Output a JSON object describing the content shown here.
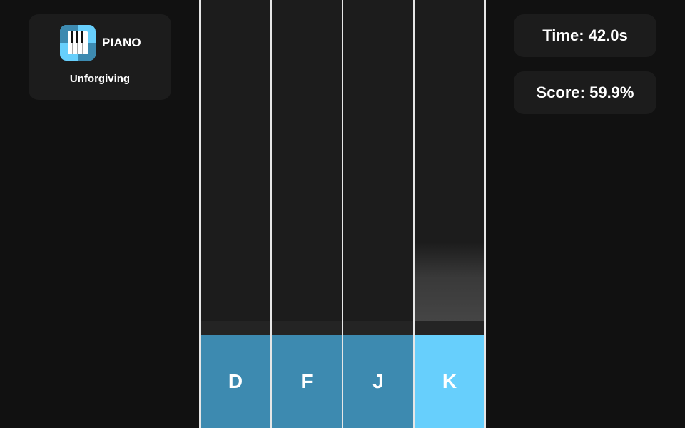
{
  "header": {
    "brand_name": "PIANO",
    "difficulty": "Unforgiving",
    "app_icon": "piano-keys-icon"
  },
  "stats": {
    "time": "Time: 42.0s",
    "score": "Score: 59.9%"
  },
  "lanes": [
    {
      "key": "D",
      "active": false
    },
    {
      "key": "F",
      "active": false
    },
    {
      "key": "J",
      "active": false
    },
    {
      "key": "K",
      "active": true
    }
  ],
  "colors": {
    "background": "#111111",
    "panel": "#1c1c1c",
    "lane_divider": "#e6e6e6",
    "key_idle": "#3d8ab0",
    "key_active": "#67cffc",
    "icon_light": "#67cffc",
    "icon_dark": "#3d8ab0"
  }
}
